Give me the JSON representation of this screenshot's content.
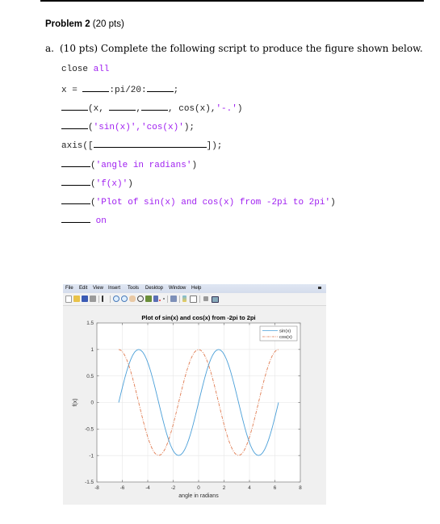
{
  "document": {
    "heading_bold": "Problem 2",
    "heading_rest": " (20 pts)",
    "question_label": "a.",
    "question_text": "(10 pts) Complete the following script to produce the figure shown below."
  },
  "code": {
    "line1_a": "close ",
    "line1_b": "all",
    "line2_a": "x = ",
    "line2_b": ":pi/20:",
    "line2_c": ";",
    "line3_a": "(x, ",
    "line3_b": ",",
    "line3_c": ", cos(x),",
    "line3_d": "'-.'",
    "line3_e": ")",
    "line4_a": "(",
    "line4_b": "'sin(x)','cos(x)'",
    "line4_c": ");",
    "line5_a": "axis([",
    "line5_b": "]);",
    "line6_a": "(",
    "line6_b": "'angle in radians'",
    "line6_c": ")",
    "line7_a": "(",
    "line7_b": "'f(x)'",
    "line7_c": ")",
    "line8_a": "(",
    "line8_b": "'Plot of sin(x) and cos(x) from -2pi to 2pi'",
    "line8_c": ")",
    "line9_b": "on"
  },
  "figure_window": {
    "menu": [
      "File",
      "Edit",
      "View",
      "Insert",
      "Tools",
      "Desktop",
      "Window",
      "Help"
    ],
    "toolbar_icons": [
      "new-figure-icon",
      "open-file-icon",
      "save-icon",
      "print-icon",
      "pointer-icon",
      "zoom-in-icon",
      "zoom-out-icon",
      "pan-icon",
      "rotate-icon",
      "data-cursor-icon",
      "brush-icon",
      "link-plot-icon",
      "colorbar-icon",
      "legend-icon",
      "hide-plot-tools-icon",
      "show-plot-tools-icon"
    ]
  },
  "chart_data": {
    "type": "line",
    "title": "Plot of sin(x) and cos(x) from -2pi to 2pi",
    "xlabel": "angle in radians",
    "ylabel": "f(x)",
    "xlim": [
      -8,
      8
    ],
    "ylim": [
      -1.5,
      1.5
    ],
    "xticks": [
      "-8",
      "-6",
      "-4",
      "-2",
      "0",
      "2",
      "4",
      "6",
      "8"
    ],
    "yticks": [
      "-1.5",
      "-1",
      "-0.5",
      "0",
      "0.5",
      "1",
      "1.5"
    ],
    "grid": true,
    "legend": "top-right",
    "x_domain": [
      -6.2832,
      6.2832
    ],
    "x_step": 0.15708,
    "series": [
      {
        "name": "sin(x)",
        "function": "sin",
        "style": "solid",
        "color": "#4a9fd8"
      },
      {
        "name": "cos(x)",
        "function": "cos",
        "style": "dash-dot",
        "color": "#e07b50"
      }
    ]
  }
}
